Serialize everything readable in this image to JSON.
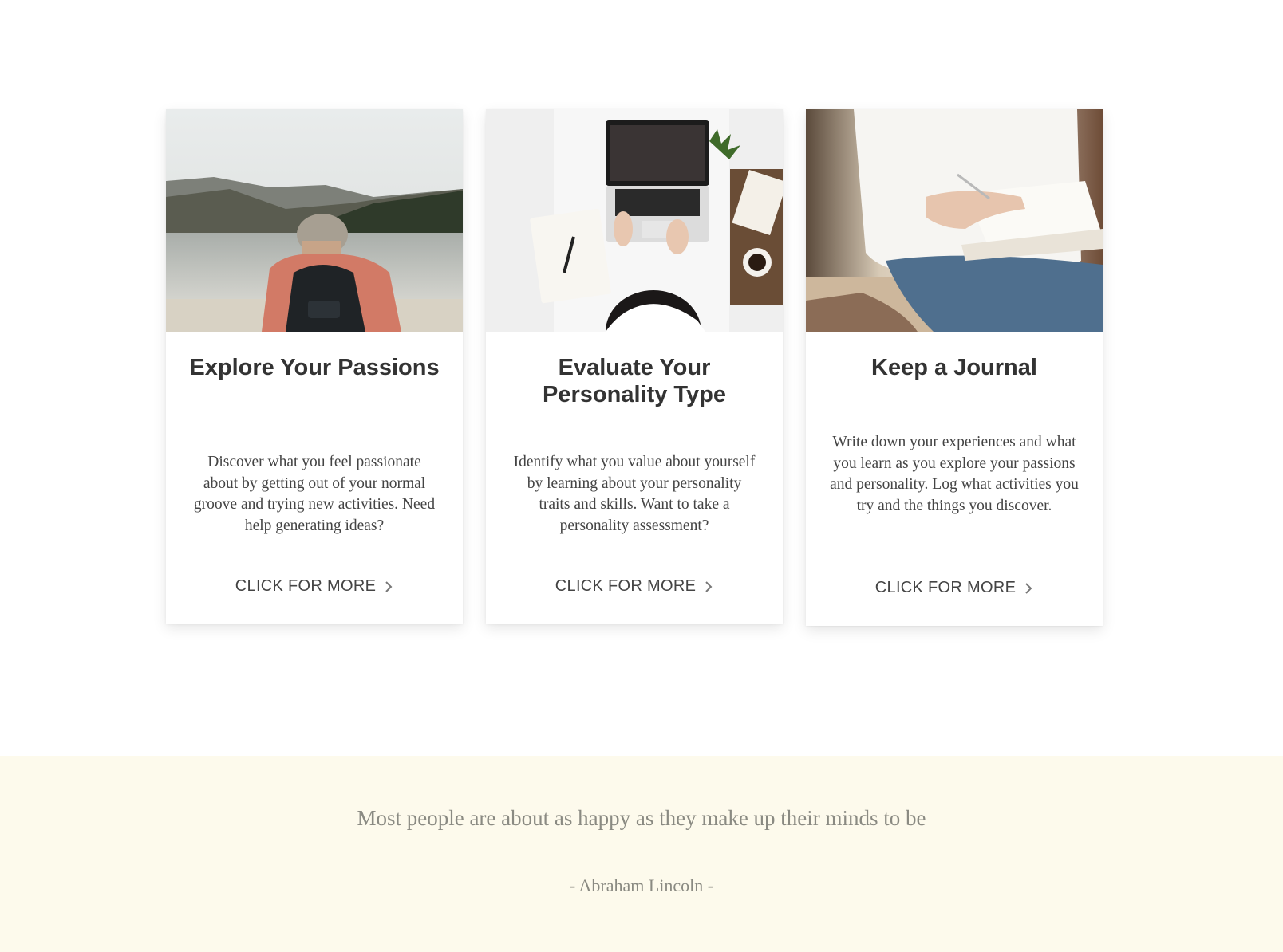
{
  "cards": [
    {
      "image_alt": "hiker-by-lake-photo",
      "title": "Explore Your Passions",
      "description": "Discover what you feel passionate about by getting out of your normal groove and trying new activities. Need help generating ideas?",
      "cta_label": "CLICK FOR MORE",
      "cta_icon": "chevron-right-icon"
    },
    {
      "image_alt": "desk-laptop-photo",
      "title": "Evaluate Your Personality Type",
      "description": "Identify what you value about yourself by learning about your personality traits and skills. Want to take a personality assessment?",
      "cta_label": "CLICK FOR MORE",
      "cta_icon": "chevron-right-icon"
    },
    {
      "image_alt": "journal-writing-photo",
      "title": "Keep a Journal",
      "description": "Write down your experiences and what you learn as you explore your passions and personality. Log what activities you try and the things you discover.",
      "cta_label": "CLICK FOR MORE",
      "cta_icon": "chevron-right-icon"
    }
  ],
  "quote": {
    "text": "Most people are about as happy as they make up their minds to be",
    "author": "- Abraham Lincoln -"
  },
  "colors": {
    "quote_band_bg": "#fdfaec",
    "quote_text": "#8a8a82",
    "title_text": "#333333"
  }
}
